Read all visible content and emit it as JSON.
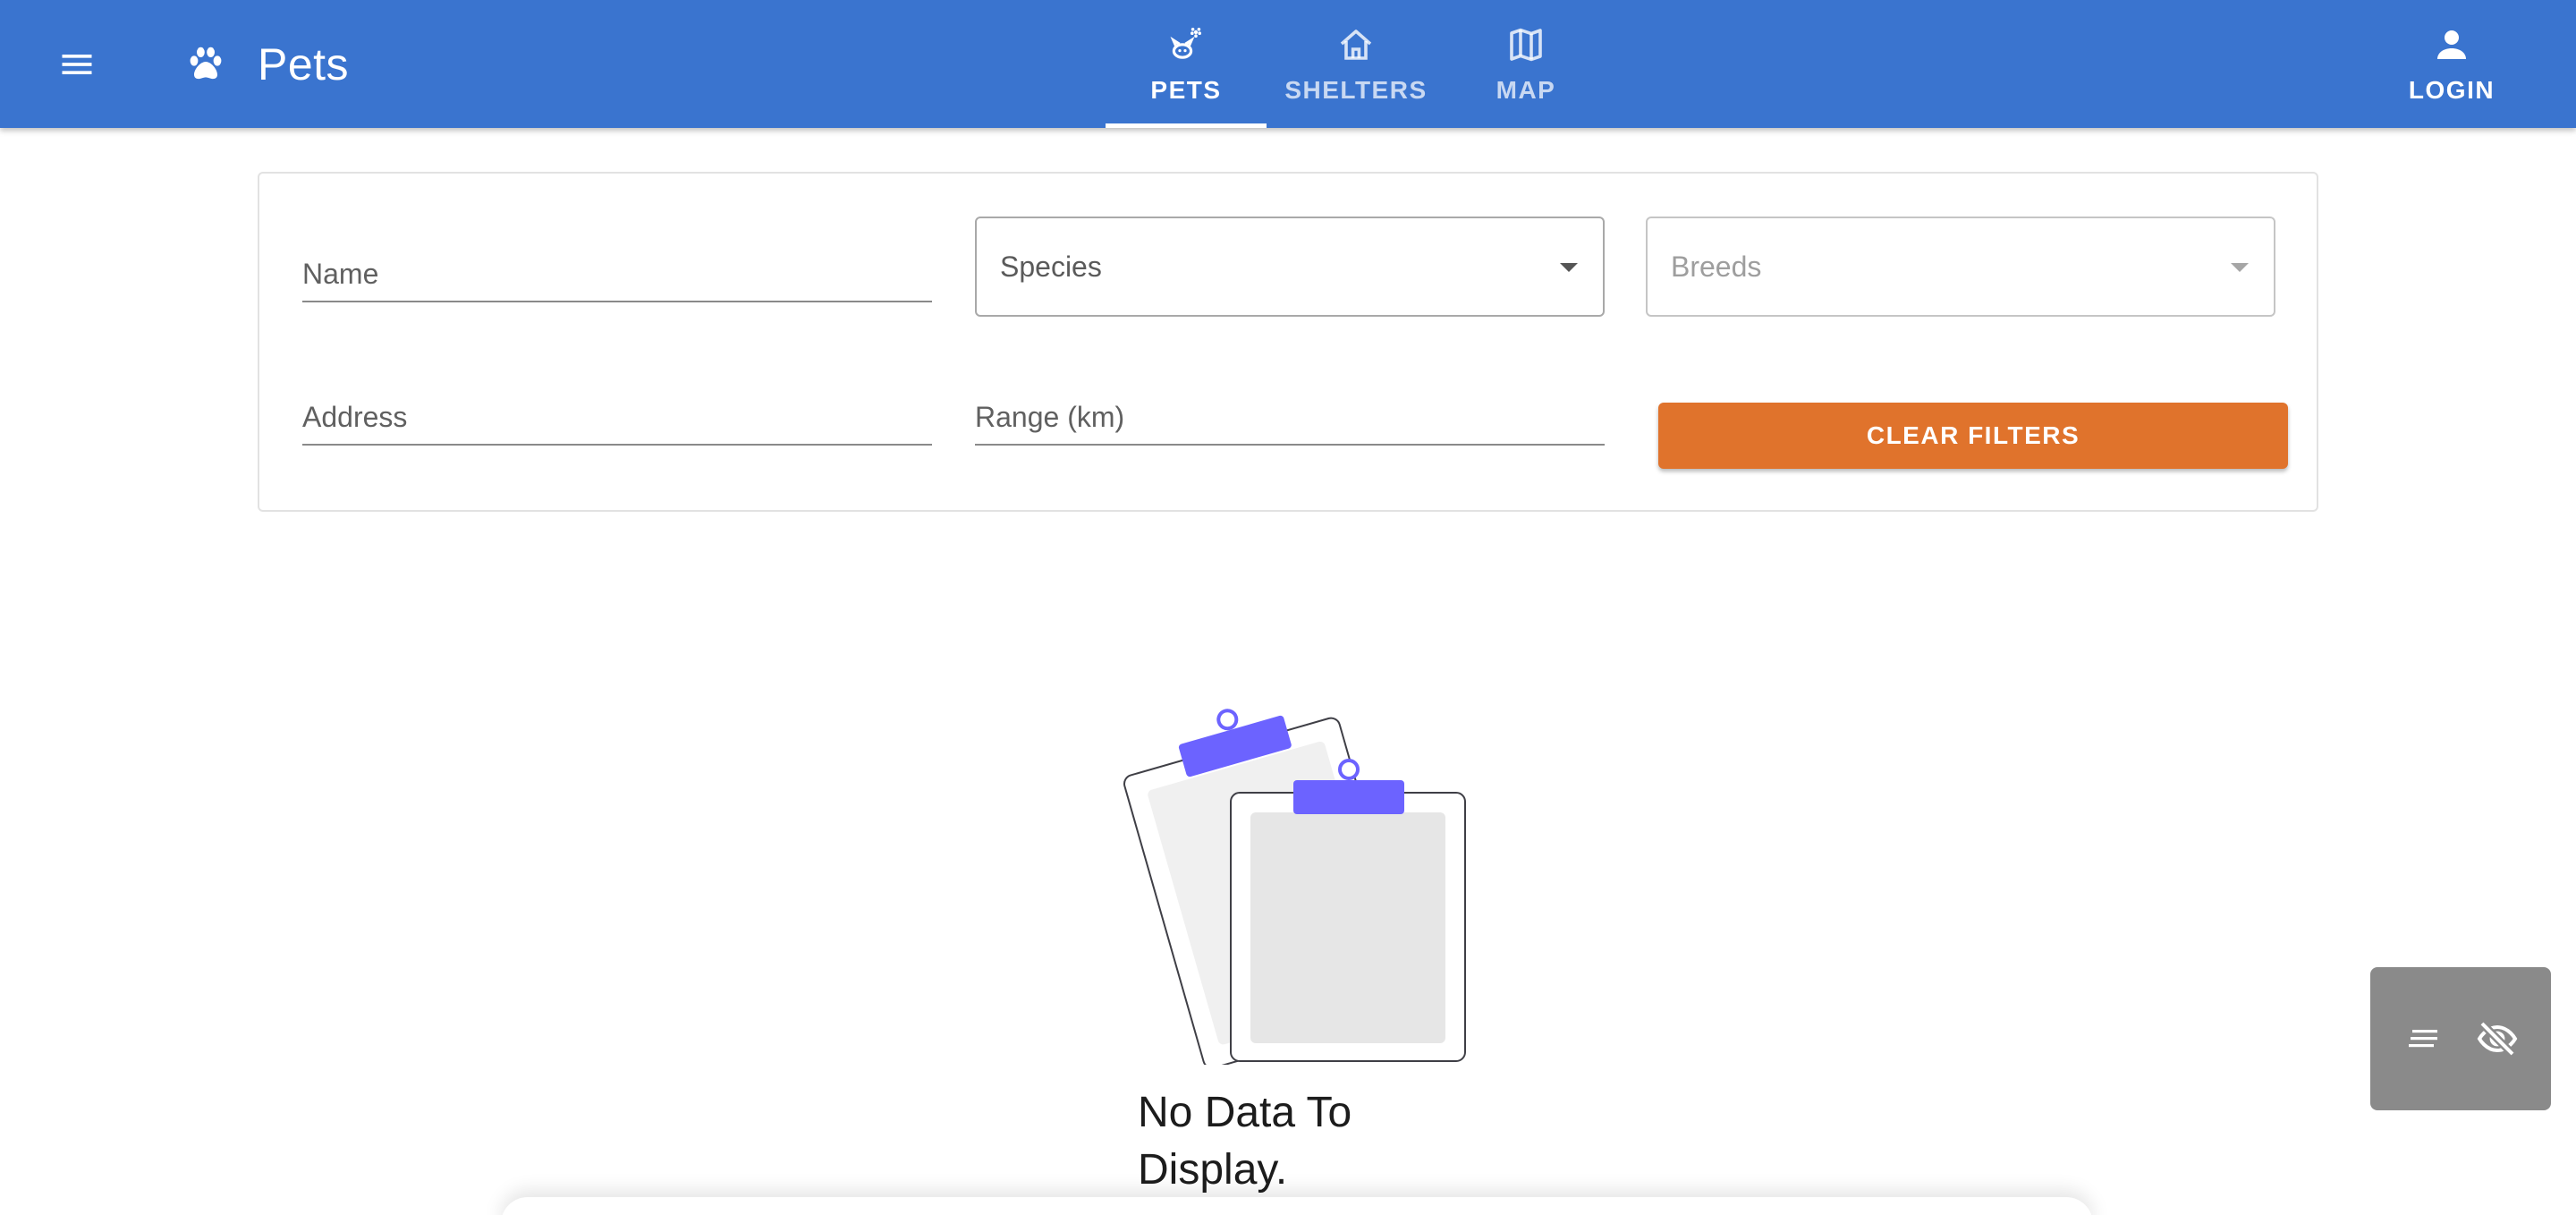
{
  "app": {
    "title": "Pets",
    "brand_icon": "paw-icon",
    "accent_color": "#3a74cf"
  },
  "nav": {
    "tabs": [
      {
        "label": "PETS",
        "icon": "pets-icon",
        "active": true
      },
      {
        "label": "SHELTERS",
        "icon": "home-icon",
        "active": false
      },
      {
        "label": "MAP",
        "icon": "map-icon",
        "active": false
      }
    ],
    "login_label": "LOGIN",
    "login_icon": "person-icon"
  },
  "filters": {
    "name_label": "Name",
    "name_value": "",
    "species_label": "Species",
    "breeds_label": "Breeds",
    "address_label": "Address",
    "address_value": "",
    "range_label": "Range (km)",
    "range_value": "",
    "clear_label": "CLEAR FILTERS",
    "clear_color": "#e0732c"
  },
  "empty_state": {
    "message": "No Data To Display."
  },
  "toolbar": {
    "icons": [
      "notes-icon",
      "visibility-off-icon"
    ]
  }
}
